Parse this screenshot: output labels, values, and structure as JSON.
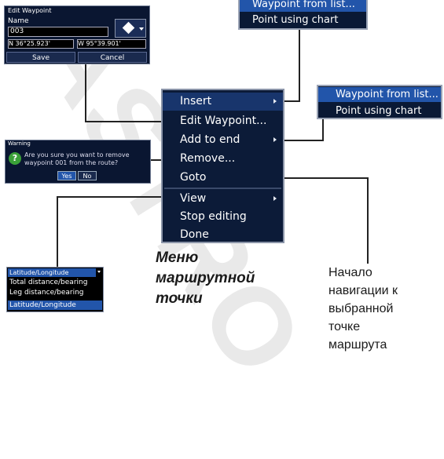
{
  "watermark": "ASTRO",
  "edit_waypoint": {
    "title": "Edit Waypoint",
    "name_label": "Name",
    "name_value": "003",
    "lat": "N  36°25.923'",
    "lon": "W  95°39.901'",
    "save": "Save",
    "cancel": "Cancel"
  },
  "submenu_top": {
    "items": [
      "Waypoint from list...",
      "Point using chart"
    ]
  },
  "submenu_mid": {
    "items": [
      "Waypoint from list...",
      "Point using chart"
    ]
  },
  "main_menu": {
    "items": [
      "Insert",
      "Edit Waypoint...",
      "Add to end",
      "Remove...",
      "Goto",
      "View",
      "Stop editing",
      "Done"
    ]
  },
  "warning": {
    "title": "Warning",
    "message_line1": "Are you sure you want to remove",
    "message_line2": "waypoint 001 from the route?",
    "yes": "Yes",
    "no": "No"
  },
  "view_list": {
    "header": "Latitude/Longitude",
    "items": [
      "Total distance/bearing",
      "Leg distance/bearing",
      "Latitude/Longitude"
    ]
  },
  "caption": {
    "line1": "Меню",
    "line2": "маршрутной",
    "line3": "точки"
  },
  "goto_note": {
    "lines": [
      "Начало",
      "навигации к",
      "выбранной",
      "точке",
      "маршрута"
    ]
  },
  "colors": {
    "menu_bg": "#0c1b38",
    "highlight": "#2255aa",
    "warning_icon": "#3aa038"
  }
}
